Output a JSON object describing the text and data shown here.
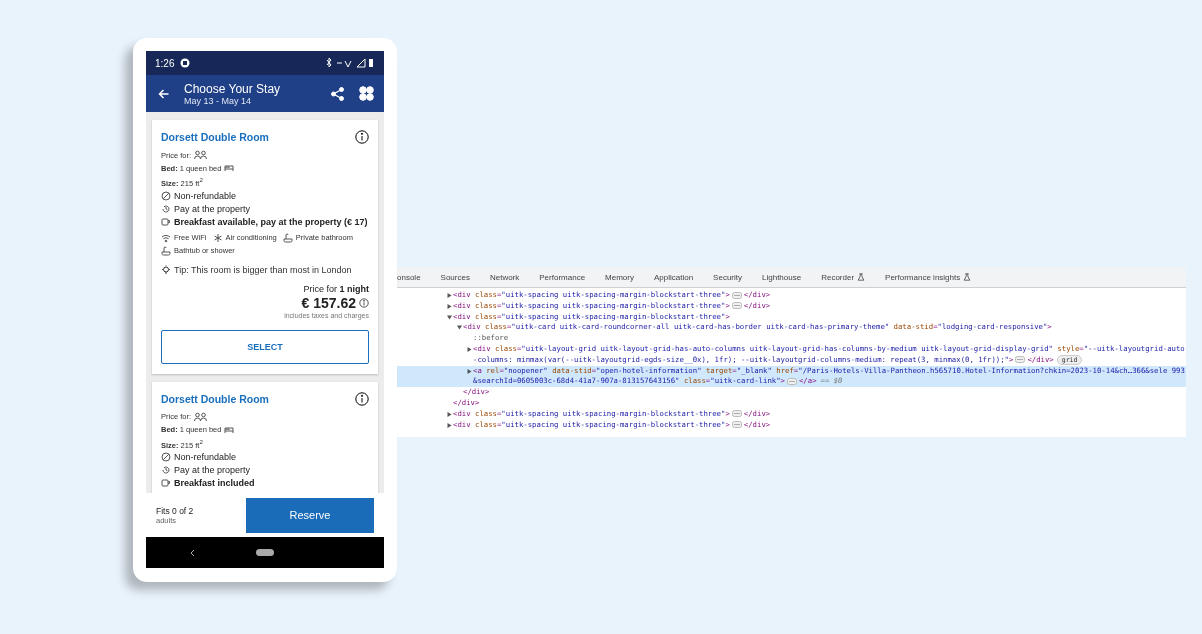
{
  "phone": {
    "status_bar": {
      "time": "1:26"
    },
    "header": {
      "title": "Choose Your Stay",
      "subtitle": "May 13 - May 14"
    },
    "rooms": [
      {
        "name": "Dorsett Double Room",
        "price_for": "Price for:",
        "bed": "**Bed:** 1 queen bed",
        "size": "**Size:** 215 ft$^{2}$",
        "policies": [
          {
            "kind": "refund",
            "text": "Non-refundable"
          },
          {
            "kind": "pay",
            "text": "Pay at the property"
          },
          {
            "kind": "breakfast",
            "text": "Breakfast available, pay at the property (€ 17)"
          }
        ],
        "amenities": [
          {
            "kind": "wifi",
            "text": "Free WiFi"
          },
          {
            "kind": "snowflake",
            "text": "Air conditioning"
          },
          {
            "kind": "bath",
            "text": "Private bathroom"
          },
          {
            "kind": "bath",
            "text": "Bathtub or shower"
          }
        ],
        "tip": "Tip: This room is bigger than most in London",
        "price": {
          "label": "Price for **1 night**",
          "amount": "€ 157.62",
          "note": "includes taxes and charges",
          "button": "SELECT"
        }
      },
      {
        "name": "Dorsett Double Room",
        "price_for": "Price for:",
        "bed": "**Bed:** 1 queen bed",
        "size": "**Size:** 215 ft$^{2}$",
        "policies": [
          {
            "kind": "refund",
            "text": "Non-refundable"
          },
          {
            "kind": "pay",
            "text": "Pay at the property"
          },
          {
            "kind": "breakfast",
            "text": "Breakfast included"
          }
        ]
      }
    ],
    "footer": {
      "fits": "Fits 0 of 2",
      "unit": "adults",
      "button": "Reserve"
    }
  },
  "devtools": {
    "tabs": [
      {
        "label": "onsole",
        "selected": false
      },
      {
        "label": "Sources",
        "selected": false
      },
      {
        "label": "Network",
        "selected": false
      },
      {
        "label": "Performance",
        "selected": false
      },
      {
        "label": "Memory",
        "selected": false
      },
      {
        "label": "Application",
        "selected": false
      },
      {
        "label": "Security",
        "selected": false
      },
      {
        "label": "Lighthouse",
        "selected": false
      },
      {
        "label": "Recorder",
        "selected": false,
        "experimental": true
      },
      {
        "label": "Performance insights",
        "selected": false,
        "experimental": true
      }
    ],
    "dom_tree": [
      {
        "open": "<div class=\"uitk-spacing uitk-spacing-margin-blockstart-three\">",
        "close": "</div>",
        "expanded": false,
        "selected": false
      },
      {
        "open": "<div class=\"uitk-spacing uitk-spacing-margin-blockstart-three\">",
        "close": "</div>",
        "expanded": false,
        "selected": false
      },
      {
        "open": "<div class=\"uitk-spacing uitk-spacing-margin-blockstart-three\">",
        "close": "</div>",
        "expanded": true,
        "selected": false,
        "children": [
          {
            "open": "<div class=\"uitk-card uitk-card-roundcorner-all uitk-card-has-border uitk-card-has-primary-theme\" data-stid=\"lodging-card-responsive\">",
            "close": "</div>",
            "expanded": true,
            "selected": false,
            "children": [
              {
                "open": "::before",
                "selected": false
              },
              {
                "open": "<div class=\"uitk-layout-grid uitk-layout-grid-has-auto-columns uitk-layout-grid-has-columns-by-medium uitk-layout-grid-display-grid\" style=\"--uitk-layoutgrid-auto-columns: minmax(var(--uitk-layoutgrid-egds-size__0x), 1fr); --uitk-layoutgrid-columns-medium: repeat(3, minmax(0, 1fr));\">",
                "close": "</div>",
                "badge": "grid",
                "expanded": false,
                "selected": false
              },
              {
                "open": "<a rel=\"noopener\" data-stid=\"open-hotel-information\" target=\"_blank\" href=\"/Paris-Hotels-Villa-Pantheon.h565710.Hotel-Information?chkin=2023-10-14&ch…366&sele 993&searchId=0605003c-68d4-41a7-907a-813157643156\" class=\"uitk-card-link\">",
                "close": "</a>",
                "suffix": "== $0",
                "expanded": false,
                "selected": true
              }
            ]
          }
        ]
      },
      {
        "open": "<div class=\"uitk-spacing uitk-spacing-margin-blockstart-three\">",
        "close": "</div>",
        "expanded": false,
        "selected": false
      },
      {
        "open": "<div class=\"uitk-spacing uitk-spacing-margin-blockstart-three\">",
        "close": "</div>",
        "expanded": false,
        "selected": false
      }
    ]
  }
}
